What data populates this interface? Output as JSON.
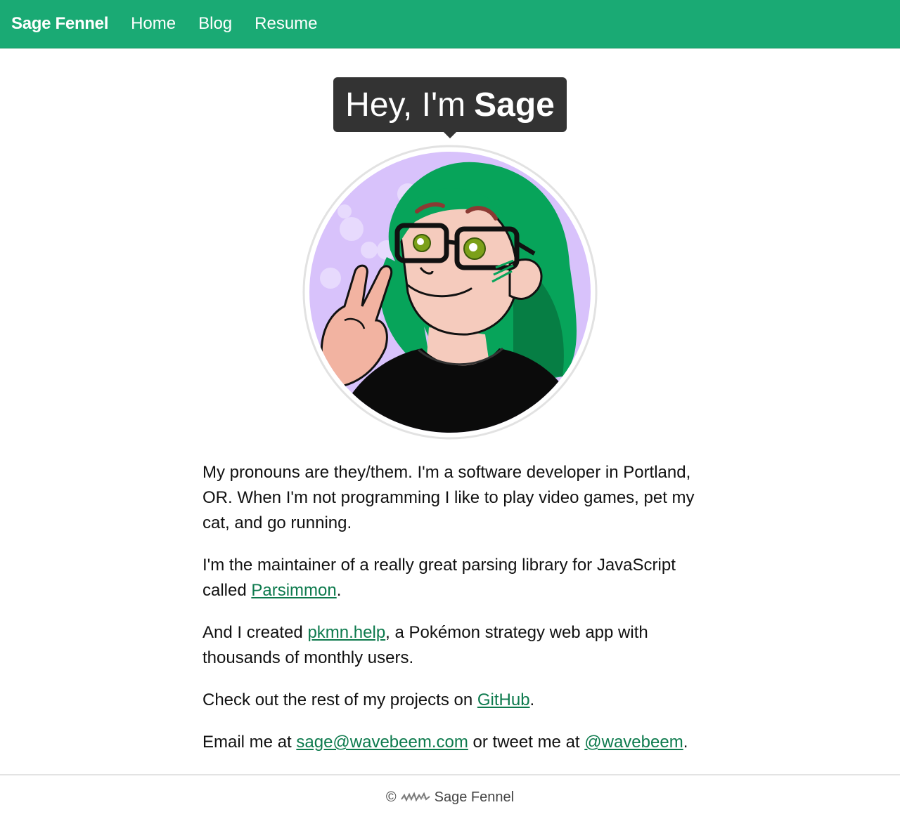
{
  "nav": {
    "brand": "Sage Fennel",
    "links": [
      "Home",
      "Blog",
      "Resume"
    ]
  },
  "hero": {
    "greeting": "Hey, I'm",
    "name": "Sage"
  },
  "paragraphs": {
    "p1": "My pronouns are they/them. I'm a software developer in Portland, OR. When I'm not programming I like to play video games, pet my cat, and go running.",
    "p2_before": "I'm the maintainer of a really great parsing library for JavaScript called ",
    "p2_link": "Parsimmon",
    "p2_after": ".",
    "p3_before": "And I created ",
    "p3_link": "pkmn.help",
    "p3_after": ", a Pokémon strategy web app with thousands of monthly users.",
    "p4_before": "Check out the rest of my projects on ",
    "p4_link": "GitHub",
    "p4_after": ".",
    "p5_before": "Email me at ",
    "p5_link_email": "sage@wavebeem.com",
    "p5_middle": " or tweet me at ",
    "p5_link_twitter": "@wavebeem",
    "p5_after": "."
  },
  "footer": {
    "copyright_symbol": "©",
    "name": "Sage Fennel"
  },
  "colors": {
    "nav_bg": "#1aaa74",
    "link": "#0d7a4d",
    "bubble_bg": "#333333",
    "avatar_bg": "#d8c2fb",
    "hair": "#0aa55c"
  }
}
